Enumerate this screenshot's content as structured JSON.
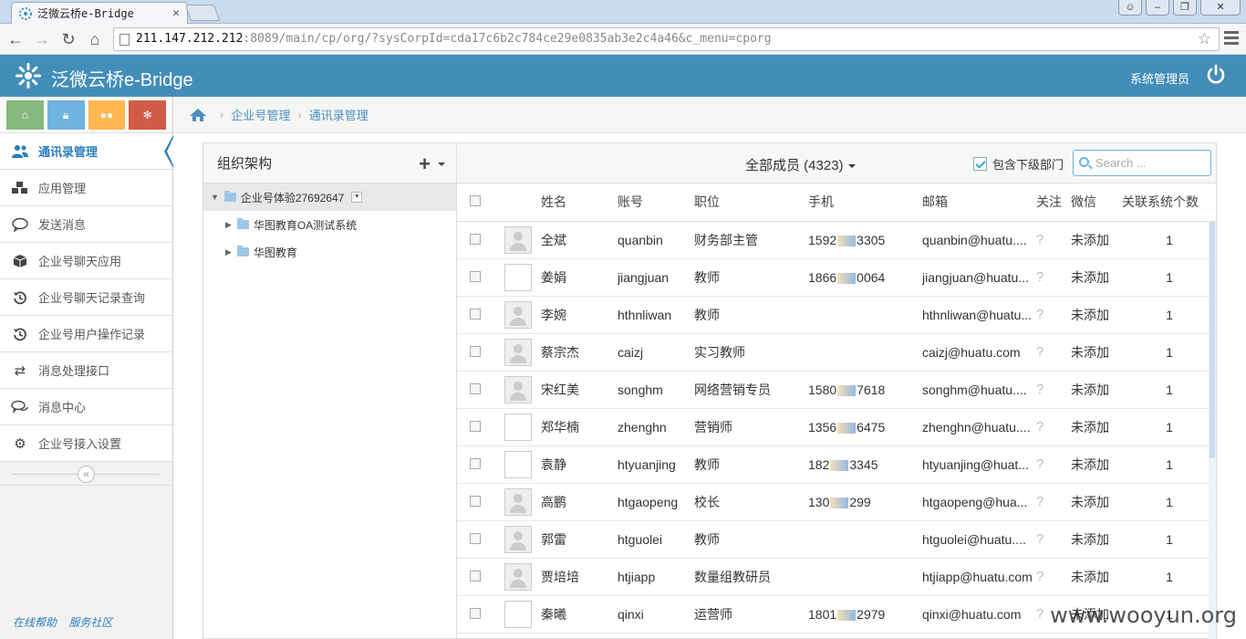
{
  "browser": {
    "tab_title": "泛微云桥e-Bridge",
    "url_host": "211.147.212.212",
    "url_rest": ":8089/main/cp/org/?sysCorpId=cda17c6b2c784ce29e0835ab3e2c4a46&c_menu=cporg"
  },
  "header": {
    "app_title": "泛微云桥e-Bridge",
    "user": "系统管理员"
  },
  "colors": {
    "header": "#438eb9",
    "accent": "#2b7dbc"
  },
  "sidebar": {
    "items": [
      {
        "label": "通讯录管理",
        "icon": "users-icon"
      },
      {
        "label": "应用管理",
        "icon": "cubes-icon"
      },
      {
        "label": "发送消息",
        "icon": "comment-icon"
      },
      {
        "label": "企业号聊天应用",
        "icon": "cube-icon"
      },
      {
        "label": "企业号聊天记录查询",
        "icon": "history-icon"
      },
      {
        "label": "企业号用户操作记录",
        "icon": "history-icon"
      },
      {
        "label": "消息处理接口",
        "icon": "exchange-icon"
      },
      {
        "label": "消息中心",
        "icon": "comments-icon"
      },
      {
        "label": "企业号接入设置",
        "icon": "gear-icon"
      }
    ],
    "footer_help": "在线帮助",
    "footer_community": "服务社区"
  },
  "breadcrumb": {
    "item1": "企业号管理",
    "item2": "通讯录管理"
  },
  "org": {
    "title": "组织架构",
    "root": "企业号体验27692647",
    "children": [
      "华图教育OA测试系统",
      "华图教育"
    ]
  },
  "members": {
    "title": "全部成员 (4323)",
    "include_sub": "包含下级部门",
    "search_placeholder": "Search ...",
    "columns": [
      "姓名",
      "账号",
      "职位",
      "手机",
      "邮箱",
      "关注",
      "微信",
      "关联系统个数"
    ],
    "rows": [
      {
        "name": "全斌",
        "account": "quanbin",
        "title": "财务部主管",
        "phone_a": "1592",
        "phone_b": "3305",
        "email": "quanbin@huatu....",
        "follow": "?",
        "wechat": "未添加",
        "count": "1",
        "avatar": "img"
      },
      {
        "name": "姜娟",
        "account": "jiangjuan",
        "title": "教师",
        "phone_a": "1866",
        "phone_b": "0064",
        "email": "jiangjuan@huatu...",
        "follow": "?",
        "wechat": "未添加",
        "count": "1",
        "avatar": "blank"
      },
      {
        "name": "李婉",
        "account": "hthnliwan",
        "title": "教师",
        "phone_a": "",
        "phone_b": "",
        "email": "hthnliwan@huatu...",
        "follow": "?",
        "wechat": "未添加",
        "count": "1",
        "avatar": "img"
      },
      {
        "name": "蔡宗杰",
        "account": "caizj",
        "title": "实习教师",
        "phone_a": "",
        "phone_b": "",
        "email": "caizj@huatu.com",
        "follow": "?",
        "wechat": "未添加",
        "count": "1",
        "avatar": "img"
      },
      {
        "name": "宋红美",
        "account": "songhm",
        "title": "网络营销专员",
        "phone_a": "1580",
        "phone_b": "7618",
        "email": "songhm@huatu....",
        "follow": "?",
        "wechat": "未添加",
        "count": "1",
        "avatar": "img"
      },
      {
        "name": "郑华楠",
        "account": "zhenghn",
        "title": "营销师",
        "phone_a": "1356",
        "phone_b": "6475",
        "email": "zhenghn@huatu....",
        "follow": "?",
        "wechat": "未添加",
        "count": "1",
        "avatar": "blank"
      },
      {
        "name": "袁静",
        "account": "htyuanjing",
        "title": "教师",
        "phone_a": "182",
        "phone_b": "3345",
        "email": "htyuanjing@huat...",
        "follow": "?",
        "wechat": "未添加",
        "count": "1",
        "avatar": "blank"
      },
      {
        "name": "高鹏",
        "account": "htgaopeng",
        "title": "校长",
        "phone_a": "130",
        "phone_b": "299",
        "email": "htgaopeng@hua...",
        "follow": "?",
        "wechat": "未添加",
        "count": "1",
        "avatar": "img"
      },
      {
        "name": "郭雷",
        "account": "htguolei",
        "title": "教师",
        "phone_a": "",
        "phone_b": "",
        "email": "htguolei@huatu....",
        "follow": "?",
        "wechat": "未添加",
        "count": "1",
        "avatar": "img"
      },
      {
        "name": "贾培培",
        "account": "htjiapp",
        "title": "数量组教研员",
        "phone_a": "",
        "phone_b": "",
        "email": "htjiapp@huatu.com",
        "follow": "?",
        "wechat": "未添加",
        "count": "1",
        "avatar": "img"
      },
      {
        "name": "秦曦",
        "account": "qinxi",
        "title": "运营师",
        "phone_a": "1801",
        "phone_b": "2979",
        "email": "qinxi@huatu.com",
        "follow": "?",
        "wechat": "未添加",
        "count": "1",
        "avatar": "blank"
      }
    ]
  },
  "watermark": "www.wooyun.org"
}
